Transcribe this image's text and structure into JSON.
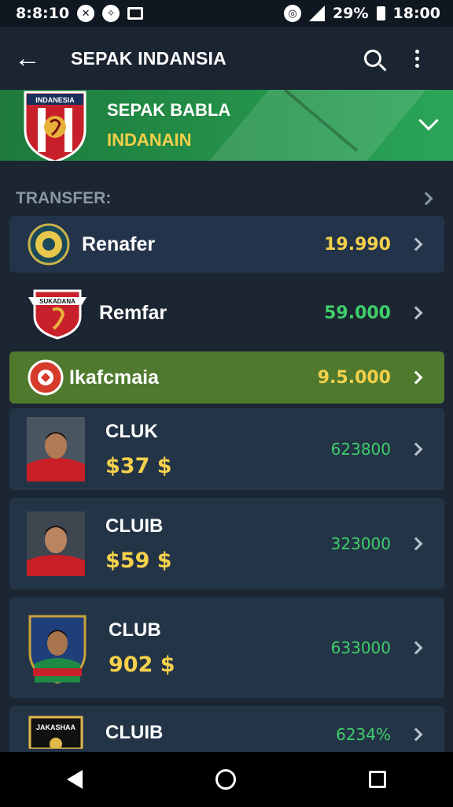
{
  "status_bar": {
    "time": "8:8:10",
    "battery": "29%",
    "clock": "18:00"
  },
  "app_bar": {
    "back_icon": "arrow-left-icon",
    "title": "SEPAK INDANSIA",
    "search_icon": "search-icon",
    "menu_icon": "more-vert-icon"
  },
  "club_header": {
    "crest_text": "INDANESIA",
    "name": "SEPAK BABLA",
    "subtitle": "INDANAIN",
    "accent": "#24924a"
  },
  "section": {
    "label": "TRANSFER:"
  },
  "rows": [
    {
      "name": "Renafer",
      "amount": "19.990",
      "amount_color": "#f4d04b"
    },
    {
      "name": "Remfar",
      "amount": "59.000",
      "amount_color": "#3fcf6a",
      "crest_text": "SUKADANA"
    },
    {
      "name": "Ikafcmaia",
      "amount": "9.5.000",
      "amount_color": "#f4d04b"
    }
  ],
  "players": [
    {
      "club": "CLUK",
      "price": "$37 $",
      "amount": "623800"
    },
    {
      "club": "CLUIB",
      "price": "$59 $",
      "amount": "323000"
    },
    {
      "club": "CLUB",
      "price": "902 $",
      "amount": "633000"
    },
    {
      "club": "CLUIB",
      "price": "",
      "amount": "6234%",
      "crest_text": "JAKASHAA"
    }
  ]
}
